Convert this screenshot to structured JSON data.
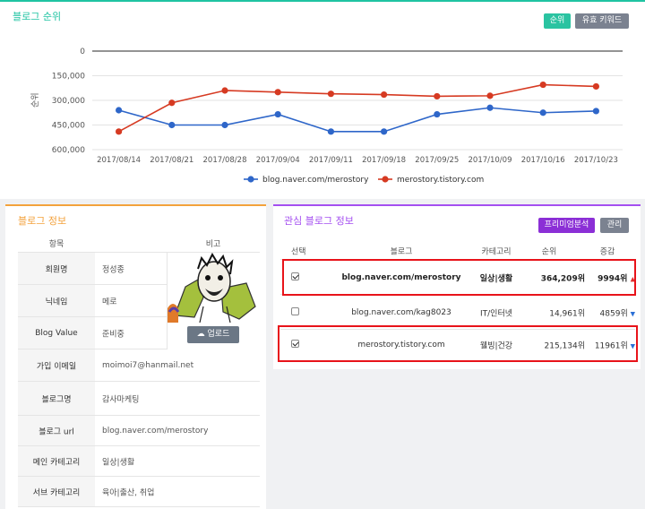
{
  "rank_panel": {
    "title": "블로그 순위",
    "btn_rank": "순위",
    "btn_keyword": "유효 키워드",
    "y_label": "순위"
  },
  "chart_data": {
    "type": "line",
    "x": [
      "2017/08/14",
      "2017/08/21",
      "2017/08/28",
      "2017/09/04",
      "2017/09/11",
      "2017/09/18",
      "2017/09/25",
      "2017/10/09",
      "2017/10/16",
      "2017/10/23"
    ],
    "y_ticks": [
      "0",
      "150,000",
      "300,000",
      "450,000",
      "600,000"
    ],
    "ylim": [
      0,
      600000
    ],
    "y_reversed": true,
    "grid": true,
    "legend": "bottom",
    "series": [
      {
        "name": "blog.naver.com/merostory",
        "color": "#2e66c9",
        "values": [
          360000,
          450000,
          450000,
          385000,
          490000,
          490000,
          385000,
          345000,
          375000,
          365000
        ]
      },
      {
        "name": "merostory.tistory.com",
        "color": "#d63a22",
        "values": [
          490000,
          315000,
          240000,
          250000,
          260000,
          265000,
          275000,
          272000,
          205000,
          215000
        ]
      }
    ]
  },
  "info_panel": {
    "title": "블로그 정보",
    "col_item": "항목",
    "col_note": "비고",
    "upload": "업로드",
    "rows": [
      {
        "key": "회원명",
        "value": "정성종"
      },
      {
        "key": "닉네임",
        "value": "메로"
      },
      {
        "key": "Blog Value",
        "value": "준비중"
      },
      {
        "key": "가입 이메일",
        "value": "moimoi7@hanmail.net"
      },
      {
        "key": "블로그명",
        "value": "감사마케팅"
      },
      {
        "key": "블로그 url",
        "value": "blog.naver.com/merostory"
      },
      {
        "key": "메인 카테고리",
        "value": "일상|생활"
      },
      {
        "key": "서브 카테고리",
        "value": "육아|출산, 취업"
      }
    ]
  },
  "interest_panel": {
    "title": "관심 블로그 정보",
    "btn_premium": "프리미엄분석",
    "btn_manage": "관리",
    "headers": {
      "select": "선택",
      "blog": "블로그",
      "category": "카테고리",
      "rank": "순위",
      "change": "증감"
    },
    "rows": [
      {
        "checked": true,
        "blog": "blog.naver.com/merostory",
        "category": "일상|생활",
        "rank": "364,209위",
        "change": "9994위",
        "direction": "up",
        "bold": true
      },
      {
        "checked": false,
        "blog": "blog.naver.com/kag8023",
        "category": "IT/인터넷",
        "rank": "14,961위",
        "change": "4859위",
        "direction": "down",
        "bold": false
      },
      {
        "checked": true,
        "blog": "merostory.tistory.com",
        "category": "웰빙|건강",
        "rank": "215,134위",
        "change": "11961위",
        "direction": "down",
        "bold": false
      }
    ]
  }
}
